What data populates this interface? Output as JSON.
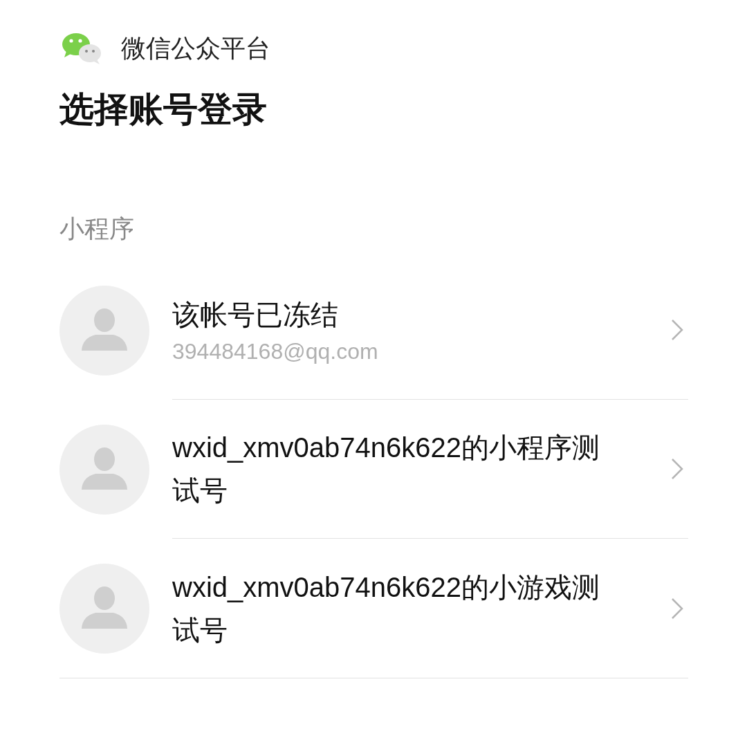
{
  "header": {
    "title": "微信公众平台"
  },
  "heading": "选择账号登录",
  "section": {
    "label": "小程序",
    "accounts": [
      {
        "name": "该帐号已冻结",
        "subtitle": "394484168@qq.com"
      },
      {
        "name": "wxid_xmv0ab74n6k622的小程序测试号"
      },
      {
        "name": "wxid_xmv0ab74n6k622的小游戏测试号"
      }
    ]
  }
}
